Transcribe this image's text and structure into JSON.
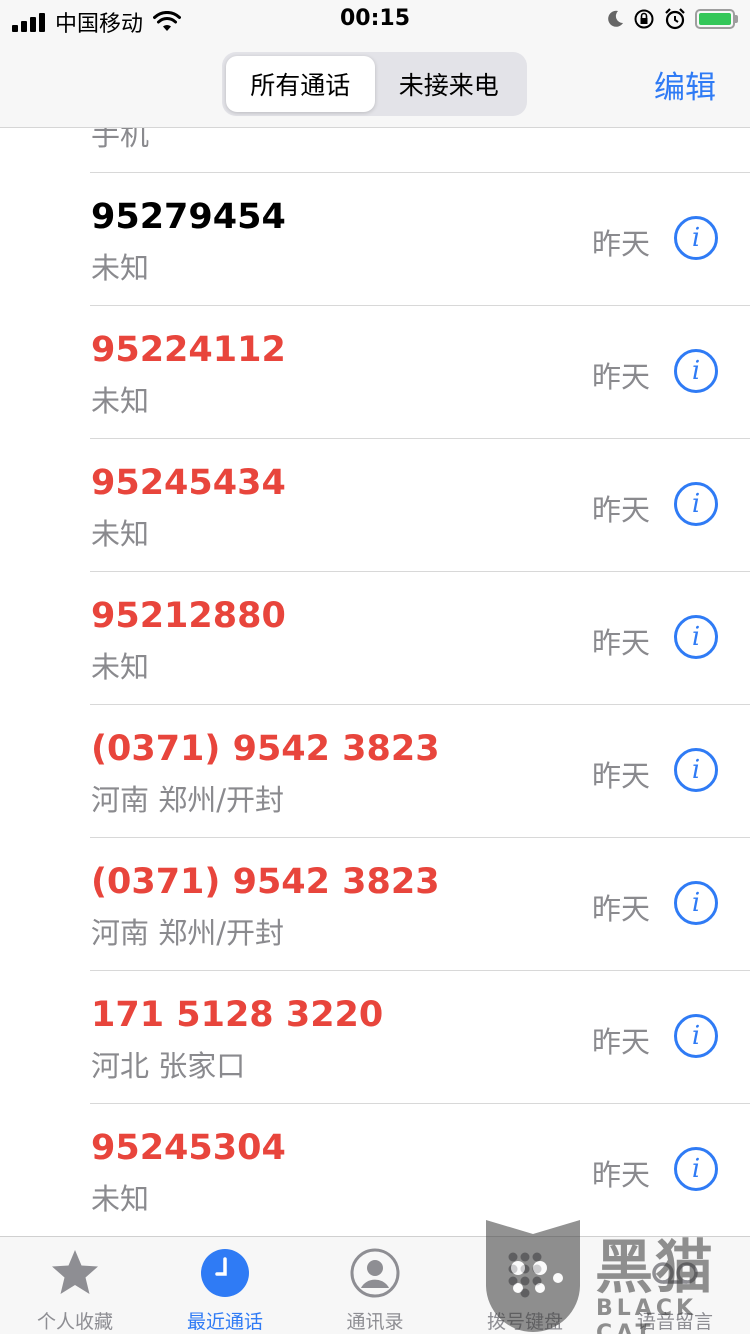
{
  "status_bar": {
    "carrier": "中国移动",
    "time": "00:15"
  },
  "nav": {
    "segments": [
      {
        "label": "所有通话",
        "active": true
      },
      {
        "label": "未接来电",
        "active": false
      }
    ],
    "edit_label": "编辑"
  },
  "partial_row": {
    "sub": "手机"
  },
  "calls": [
    {
      "number": "95279454",
      "sub": "未知",
      "date": "昨天",
      "missed": false
    },
    {
      "number": "95224112",
      "sub": "未知",
      "date": "昨天",
      "missed": true
    },
    {
      "number": "95245434",
      "sub": "未知",
      "date": "昨天",
      "missed": true
    },
    {
      "number": "95212880",
      "sub": "未知",
      "date": "昨天",
      "missed": true
    },
    {
      "number": "(0371) 9542 3823",
      "sub": "河南 郑州/开封",
      "date": "昨天",
      "missed": true
    },
    {
      "number": "(0371) 9542 3823",
      "sub": "河南 郑州/开封",
      "date": "昨天",
      "missed": true
    },
    {
      "number": "171 5128 3220",
      "sub": "河北 张家口",
      "date": "昨天",
      "missed": true
    },
    {
      "number": "95245304",
      "sub": "未知",
      "date": "昨天",
      "missed": true
    }
  ],
  "tabs": [
    {
      "label": "个人收藏",
      "icon": "star-icon",
      "active": false
    },
    {
      "label": "最近通话",
      "icon": "clock-icon",
      "active": true
    },
    {
      "label": "通讯录",
      "icon": "person-icon",
      "active": false
    },
    {
      "label": "拨号键盘",
      "icon": "keypad-icon",
      "active": false
    },
    {
      "label": "语音留言",
      "icon": "voicemail-icon",
      "active": false
    }
  ],
  "watermark": {
    "text": "黑猫",
    "sub": "BLACK CAT"
  },
  "colors": {
    "accent": "#2f7bf5",
    "missed": "#e8453c",
    "secondary_text": "#8a8a8e",
    "battery": "#34c759"
  }
}
